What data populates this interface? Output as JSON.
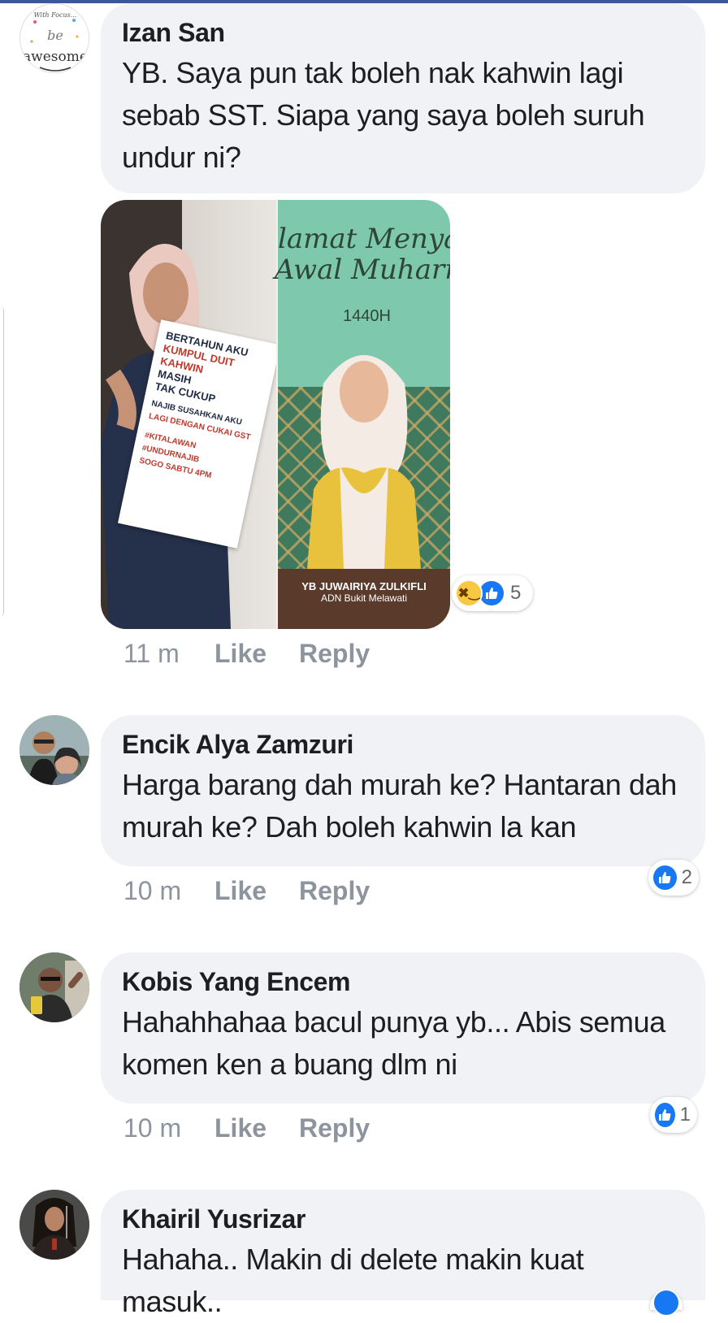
{
  "comments": [
    {
      "name": "Izan San",
      "text": "YB. Saya pun tak boleh nak kahwin lagi sebab SST. Siapa yang saya boleh suruh undur ni?",
      "time": "11 m",
      "like": "Like",
      "reply": "Reply",
      "reaction_count": "5",
      "avatar_text": {
        "script": "With Focus...",
        "be": "be",
        "awesome": "awesome"
      }
    },
    {
      "name": "Encik Alya Zamzuri",
      "text": "Harga barang dah murah ke? Hantaran dah murah ke? Dah boleh kahwin la kan",
      "time": "10 m",
      "like": "Like",
      "reply": "Reply",
      "reaction_count": "2"
    },
    {
      "name": "Kobis Yang Encem",
      "text": "Hahahhahaa bacul punya yb...  Abis semua komen ken a buang dlm ni",
      "time": "10 m",
      "like": "Like",
      "reply": "Reply",
      "reaction_count": "1"
    },
    {
      "name": "Khairil Yusrizar",
      "text": "Hahaha.. Makin di delete makin kuat masuk.."
    }
  ],
  "attachment": {
    "left_sign": [
      "BERTAHUN AKU",
      "KUMPUL DUIT",
      "KAHWIN",
      "MASIH",
      "TAK CUKUP",
      "NAJIB SUSAHKAN AKU",
      "LAGI DENGAN CUKAI GST",
      "#KITALAWAN #UNDURNAJIB",
      "SOGO SABTU 4PM"
    ],
    "right_title_1": "lamat Menyam",
    "right_title_2": "Awal Muharra",
    "right_year": "1440H",
    "right_caption_name": "YB JUWAIRIYA ZULKIFLI",
    "right_caption_sub": "ADN Bukit Melawati"
  },
  "colors": {
    "accent": "#1877f2",
    "bubble": "#f0f2f5",
    "meta": "#8d949e",
    "teal_card": "#7ec8ae"
  }
}
